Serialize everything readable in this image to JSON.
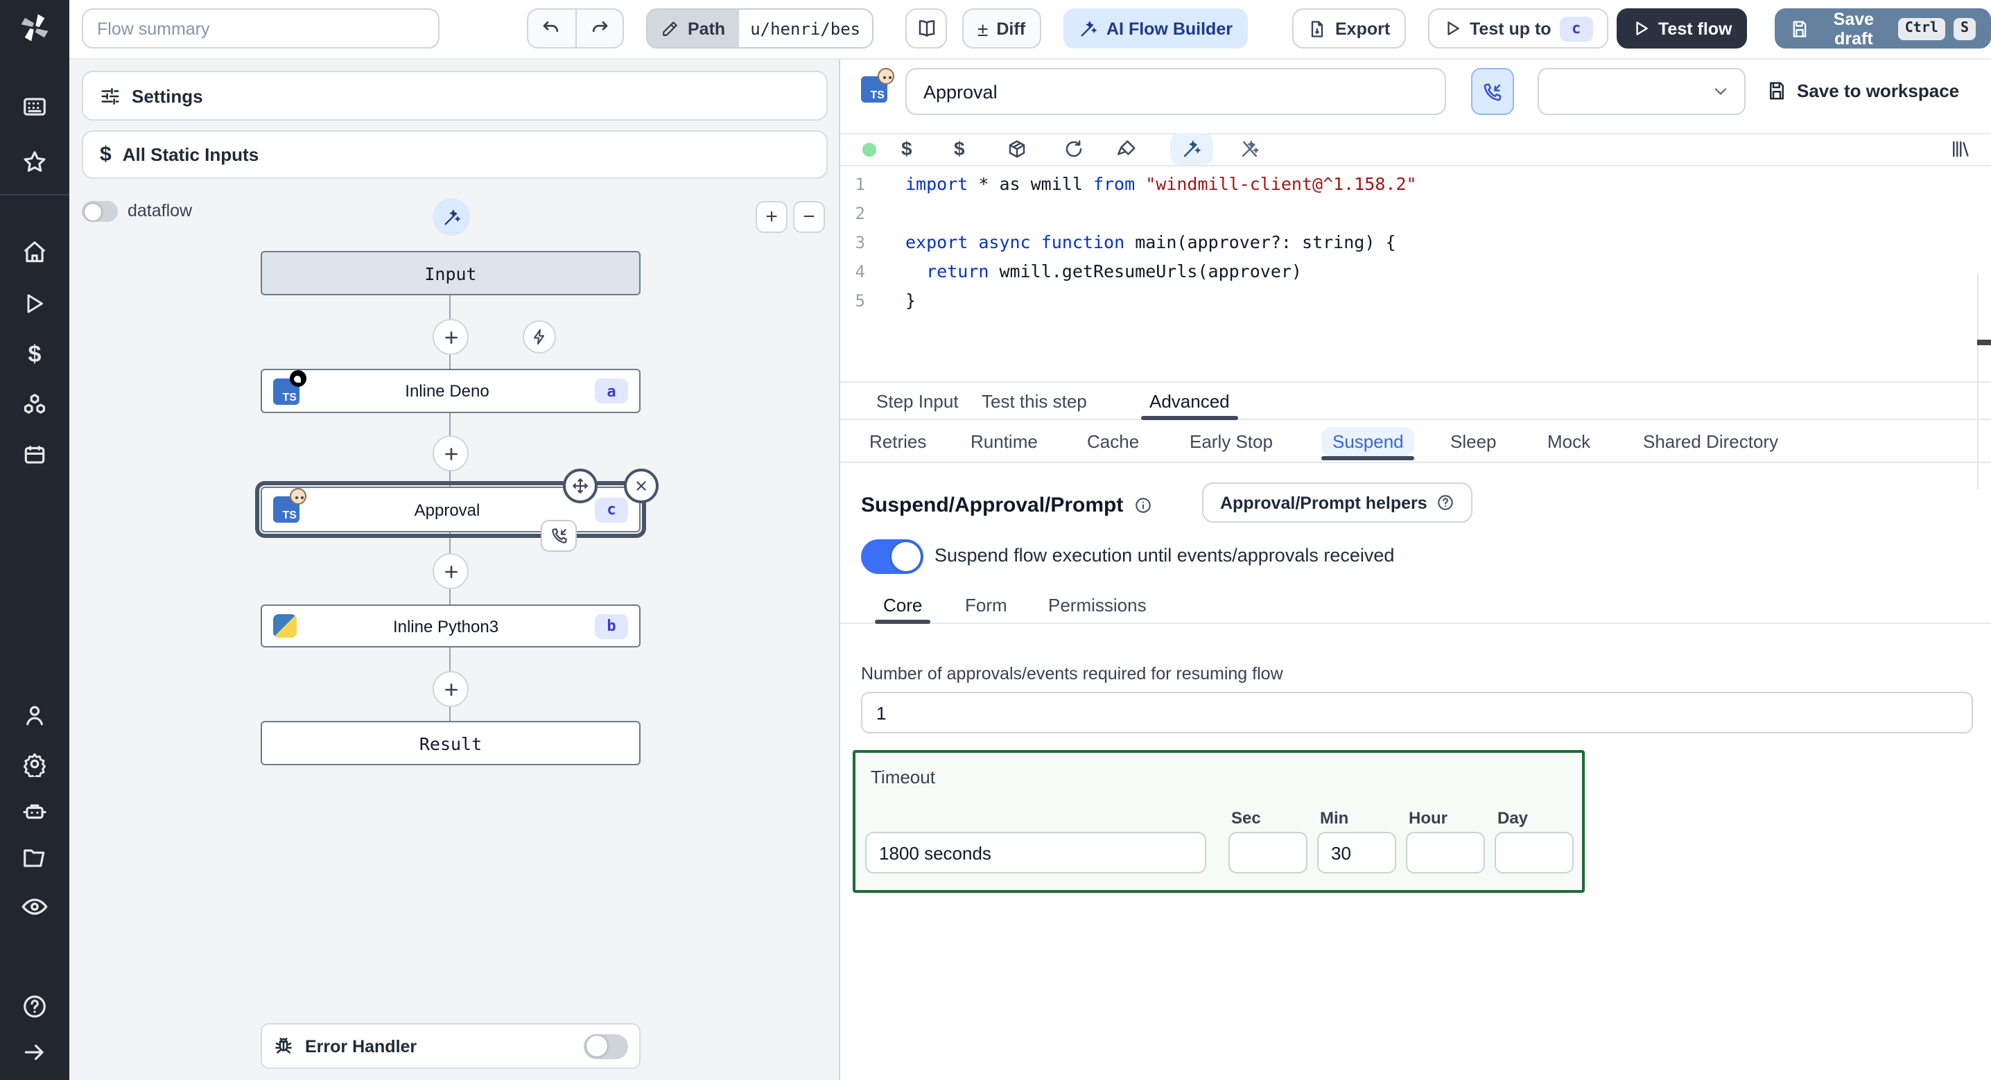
{
  "topbar": {
    "flow_summary_placeholder": "Flow summary",
    "path_label": "Path",
    "path_value": "u/henri/bes",
    "diff_label": "Diff",
    "diff_prefix": "±",
    "ai_flow_builder_label": "AI Flow Builder",
    "export_label": "Export",
    "test_up_to_label": "Test up to",
    "test_up_to_badge": "c",
    "test_flow_label": "Test flow",
    "save_draft_label": "Save draft",
    "kbd_ctrl": "Ctrl",
    "kbd_s": "S"
  },
  "sidebar": {
    "icons": [
      "command-palette-icon",
      "star-icon",
      "home-icon",
      "runs-icon",
      "variables-icon",
      "resources-icon",
      "schedules-icon",
      "users-icon",
      "settings-icon",
      "workers-icon",
      "folders-icon",
      "audit-logs-icon",
      "help-icon",
      "expand-icon"
    ]
  },
  "flow_panel": {
    "settings_label": "Settings",
    "static_inputs_label": "All Static Inputs",
    "dataflow_label": "dataflow",
    "zoom_in": "+",
    "zoom_out": "−",
    "nodes": [
      {
        "label": "Input"
      },
      {
        "label": "Inline Deno",
        "badge": "a"
      },
      {
        "label": "Approval",
        "badge": "c"
      },
      {
        "label": "Inline Python3",
        "badge": "b"
      },
      {
        "label": "Result"
      }
    ],
    "error_handler_label": "Error Handler"
  },
  "step_editor": {
    "title_value": "Approval",
    "save_to_workspace_label": "Save to workspace",
    "code": {
      "lines": [
        {
          "n": "1",
          "spans": [
            {
              "c": "kw",
              "t": "import"
            },
            {
              "c": "",
              "t": " * as wmill "
            },
            {
              "c": "kw",
              "t": "from"
            },
            {
              "c": "str",
              "t": " \"windmill-client@^1.158.2\""
            }
          ]
        },
        {
          "n": "2",
          "spans": []
        },
        {
          "n": "3",
          "spans": [
            {
              "c": "kw",
              "t": "export"
            },
            {
              "c": "",
              "t": " "
            },
            {
              "c": "kw",
              "t": "async"
            },
            {
              "c": "",
              "t": " "
            },
            {
              "c": "kw",
              "t": "function"
            },
            {
              "c": "",
              "t": " main(approver?: string) {"
            }
          ]
        },
        {
          "n": "4",
          "spans": [
            {
              "c": "",
              "t": "  "
            },
            {
              "c": "kw",
              "t": "return"
            },
            {
              "c": "",
              "t": " wmill.getResumeUrls(approver)"
            }
          ]
        },
        {
          "n": "5",
          "spans": [
            {
              "c": "",
              "t": "}"
            }
          ]
        }
      ]
    },
    "tabs": [
      "Step Input",
      "Test this step",
      "Advanced"
    ],
    "active_tab": "Advanced",
    "subtabs": [
      "Retries",
      "Runtime",
      "Cache",
      "Early Stop",
      "Suspend",
      "Sleep",
      "Mock",
      "Shared Directory"
    ],
    "active_subtab": "Suspend",
    "suspend": {
      "heading": "Suspend/Approval/Prompt",
      "helpers_button_label": "Approval/Prompt helpers",
      "toggle_label": "Suspend flow execution until events/approvals received",
      "toggle_on": true,
      "tabs": [
        "Core",
        "Form",
        "Permissions"
      ],
      "active_tab": "Core",
      "approvals_label": "Number of approvals/events required for resuming flow",
      "approvals_value": "1",
      "timeout": {
        "label": "Timeout",
        "display_value": "1800 seconds",
        "units": [
          "Sec",
          "Min",
          "Hour",
          "Day"
        ],
        "sec_value": "",
        "min_value": "30",
        "hour_value": "",
        "day_value": ""
      }
    }
  },
  "colors": {
    "rail_bg": "#21262f",
    "accent_blue": "#3b6ff5",
    "ai_button_bg": "#dbeafe",
    "test_flow_bg": "#2b313f",
    "save_draft_bg": "#64809f",
    "badge_bg": "#e0e7ff",
    "badge_text": "#4338ca",
    "timeout_border": "#1d6b37",
    "status_dot": "#8be3a2",
    "keyword": "#0432c8",
    "string": "#a31515"
  }
}
